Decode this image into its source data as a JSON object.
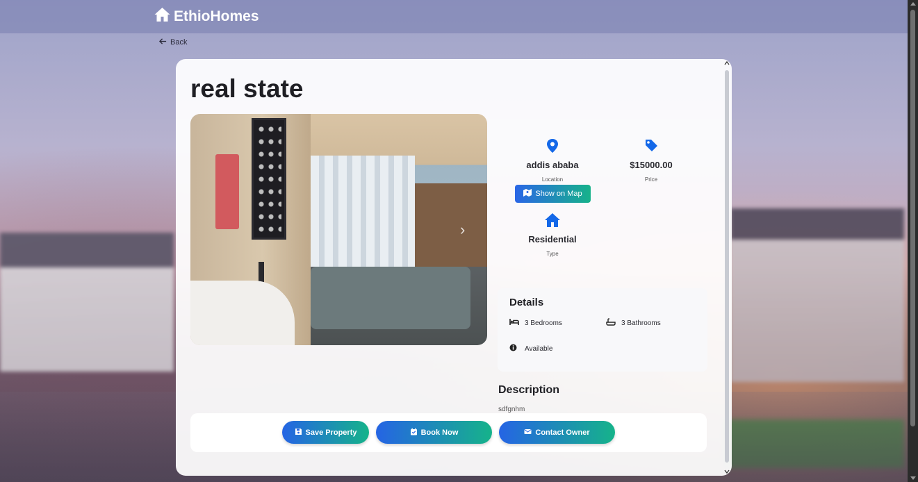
{
  "app": {
    "brand": "EthioHomes"
  },
  "nav": {
    "back_label": "Back"
  },
  "property": {
    "title": "real state",
    "location": {
      "value": "addis ababa",
      "label": "Location"
    },
    "price": {
      "value": "$15000.00",
      "label": "Price"
    },
    "map_button_label": "Show on Map",
    "type": {
      "value": "Residential",
      "label": "Type"
    },
    "details": {
      "title": "Details",
      "bedrooms": "3 Bedrooms",
      "bathrooms": "3 Bathrooms",
      "status": "Available"
    },
    "description": {
      "title": "Description",
      "text": "sdfgnhm"
    }
  },
  "actions": {
    "save_label": "Save Property",
    "book_label": "Book Now",
    "contact_label": "Contact Owner"
  },
  "icons": {
    "brand": "home-icon",
    "back": "arrow-left-icon",
    "location": "map-pin-icon",
    "price": "tag-icon",
    "map": "map-icon",
    "type": "home-icon",
    "bedrooms": "bed-icon",
    "bathrooms": "bath-icon",
    "status": "info-icon",
    "save": "floppy-disk-icon",
    "book": "calendar-check-icon",
    "contact": "envelope-icon",
    "carousel_next": "chevron-right-icon"
  },
  "colors": {
    "accent_start": "#2564e4",
    "accent_end": "#16b38a",
    "icon_blue": "#1468e8"
  }
}
